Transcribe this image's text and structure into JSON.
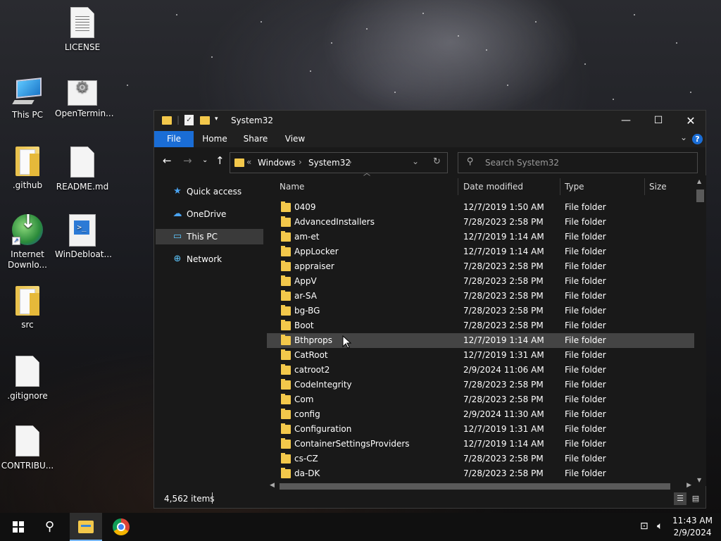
{
  "desktop": {
    "icons": [
      {
        "label": "LICENSE",
        "icon": "document-icon"
      },
      {
        "label": "This PC",
        "icon": "computer-icon"
      },
      {
        "label": "OpenTermin...",
        "icon": "settings-app-icon"
      },
      {
        "label": ".github",
        "icon": "folder-icon"
      },
      {
        "label": "README.md",
        "icon": "document-icon"
      },
      {
        "label": "Internet Downlo...",
        "icon": "download-manager-icon"
      },
      {
        "label": "WinDebloat...",
        "icon": "powershell-script-icon"
      },
      {
        "label": "src",
        "icon": "folder-icon"
      },
      {
        "label": ".gitignore",
        "icon": "document-icon"
      },
      {
        "label": "CONTRIBU...",
        "icon": "document-icon"
      }
    ]
  },
  "window": {
    "title": "System32",
    "ribbon_tabs": [
      "File",
      "Home",
      "Share",
      "View"
    ],
    "help_label": "?",
    "address": {
      "overflow": "«",
      "crumbs": [
        "Windows",
        "System32"
      ]
    },
    "search": {
      "placeholder": "Search System32"
    },
    "nav_pane": [
      {
        "label": "Quick access",
        "icon": "star-icon"
      },
      {
        "label": "OneDrive",
        "icon": "cloud-icon"
      },
      {
        "label": "This PC",
        "icon": "computer-icon",
        "selected": true
      },
      {
        "label": "Network",
        "icon": "network-icon"
      }
    ],
    "columns": [
      "Name",
      "Date modified",
      "Type",
      "Size"
    ],
    "files": [
      {
        "name": "0409",
        "date": "12/7/2019 1:50 AM",
        "type": "File folder"
      },
      {
        "name": "AdvancedInstallers",
        "date": "7/28/2023 2:58 PM",
        "type": "File folder"
      },
      {
        "name": "am-et",
        "date": "12/7/2019 1:14 AM",
        "type": "File folder"
      },
      {
        "name": "AppLocker",
        "date": "12/7/2019 1:14 AM",
        "type": "File folder"
      },
      {
        "name": "appraiser",
        "date": "7/28/2023 2:58 PM",
        "type": "File folder"
      },
      {
        "name": "AppV",
        "date": "7/28/2023 2:58 PM",
        "type": "File folder"
      },
      {
        "name": "ar-SA",
        "date": "7/28/2023 2:58 PM",
        "type": "File folder"
      },
      {
        "name": "bg-BG",
        "date": "7/28/2023 2:58 PM",
        "type": "File folder"
      },
      {
        "name": "Boot",
        "date": "7/28/2023 2:58 PM",
        "type": "File folder"
      },
      {
        "name": "Bthprops",
        "date": "12/7/2019 1:14 AM",
        "type": "File folder",
        "hover": true
      },
      {
        "name": "CatRoot",
        "date": "12/7/2019 1:31 AM",
        "type": "File folder"
      },
      {
        "name": "catroot2",
        "date": "2/9/2024 11:06 AM",
        "type": "File folder"
      },
      {
        "name": "CodeIntegrity",
        "date": "7/28/2023 2:58 PM",
        "type": "File folder"
      },
      {
        "name": "Com",
        "date": "7/28/2023 2:58 PM",
        "type": "File folder"
      },
      {
        "name": "config",
        "date": "2/9/2024 11:30 AM",
        "type": "File folder"
      },
      {
        "name": "Configuration",
        "date": "12/7/2019 1:31 AM",
        "type": "File folder"
      },
      {
        "name": "ContainerSettingsProviders",
        "date": "12/7/2019 1:14 AM",
        "type": "File folder"
      },
      {
        "name": "cs-CZ",
        "date": "7/28/2023 2:58 PM",
        "type": "File folder"
      },
      {
        "name": "da-DK",
        "date": "7/28/2023 2:58 PM",
        "type": "File folder"
      }
    ],
    "status": {
      "item_count": "4,562 items"
    }
  },
  "taskbar": {
    "apps": [
      "start-icon",
      "search-icon",
      "file-explorer-icon",
      "chrome-icon"
    ],
    "clock": {
      "time": "11:43 AM",
      "date": "2/9/2024"
    }
  },
  "colors": {
    "accent": "#1a6dd6",
    "folder": "#f3c84b",
    "window_bg": "#191919",
    "hover_row": "#444444"
  }
}
